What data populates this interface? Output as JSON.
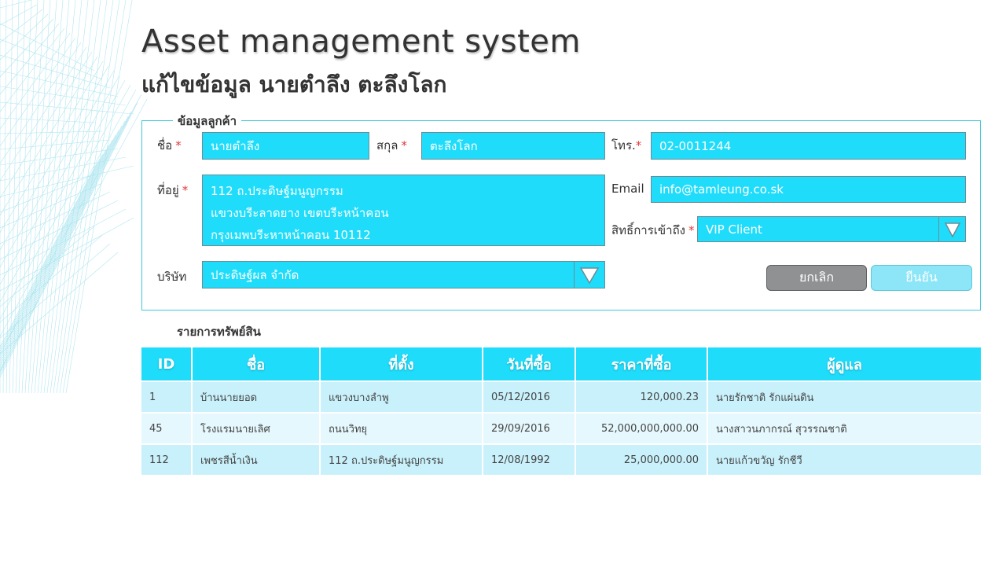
{
  "app_title": "Asset management system",
  "page_subtitle": "แก้ไขข้อมูล นายตำลึง ตะลึงโลก",
  "customer_form": {
    "legend": "ข้อมูลลูกค้า",
    "required_mark": "*",
    "first_name": {
      "label": "ชื่อ",
      "value": "นายตำลึง"
    },
    "last_name": {
      "label": "สกุล",
      "value": "ตะลึงโลก"
    },
    "phone": {
      "label": "โทร.",
      "value": "02-0011244"
    },
    "address": {
      "label": "ที่อยู่",
      "lines": [
        "112 ถ.ประดิษฐ์มนูญกรรม",
        "แขวงบรีะลาดยาง เขตบรีะหน้าคอน",
        "กรุงเมพบรีะหาหน้าคอน 10112"
      ]
    },
    "email": {
      "label": "Email",
      "value": "info@tamleung.co.sk"
    },
    "access": {
      "label": "สิทธิ์การเข้าถึง",
      "value": "VIP Client"
    },
    "company": {
      "label": "บริษัท",
      "value": "ประดิษฐ์ผล จำกัด"
    },
    "cancel_label": "ยกเลิก",
    "confirm_label": "ยืนยัน"
  },
  "assets": {
    "section_title": "รายการทรัพย์สิน",
    "columns": [
      "ID",
      "ชื่อ",
      "ที่ตั้ง",
      "วันที่ซื้อ",
      "ราคาที่ซื้อ",
      "ผู้ดูแล"
    ],
    "rows": [
      [
        "1",
        "บ้านนายยอด",
        "แขวงบางลำพู",
        "05/12/2016",
        "120,000.23",
        "นายรักชาติ รักแผ่นดิน"
      ],
      [
        "45",
        "โรงแรมนายเลิศ",
        "ถนนวิทยุ",
        "29/09/2016",
        "52,000,000,000.00",
        "นางสาวนภากรณ์ สุวรรณชาติ"
      ],
      [
        "112",
        "เพชรสีน้ำเงิน",
        "112 ถ.ประดิษฐ์มนูญกรรม",
        "12/08/1992",
        "25,000,000.00",
        "นายแก้วขวัญ รักชีวี"
      ]
    ]
  },
  "colors": {
    "field_bg": "#1fdcfa",
    "header_bg": "#1fdcfa",
    "row_odd": "#c9f1fb",
    "row_even": "#e5f8fd",
    "required": "#e03a3a",
    "panel_border": "#3ec8dc"
  },
  "icons": {
    "dropdown": "triangle-down-icon",
    "background": "wireframe-decoration"
  }
}
